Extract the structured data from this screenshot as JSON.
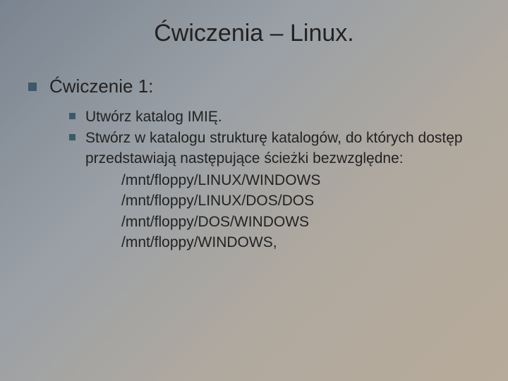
{
  "title": "Ćwiczenia – Linux.",
  "heading": "Ćwiczenie 1:",
  "items": [
    "Utwórz katalog IMIĘ.",
    "Stwórz w katalogu strukturę katalogów, do których dostęp przedstawiają następujące ścieżki bezwzględne:"
  ],
  "paths": [
    "/mnt/floppy/LINUX/WINDOWS",
    "/mnt/floppy/LINUX/DOS/DOS",
    "/mnt/floppy/DOS/WINDOWS",
    "/mnt/floppy/WINDOWS,"
  ]
}
